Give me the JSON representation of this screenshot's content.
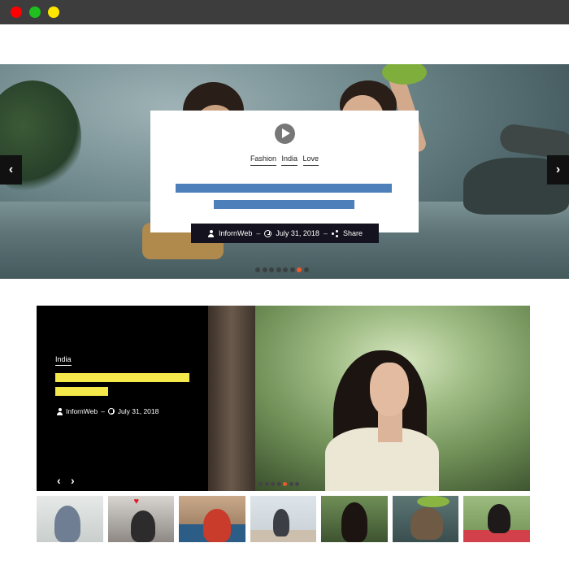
{
  "window": {
    "controls": [
      "close",
      "minimize",
      "maximize"
    ]
  },
  "hero": {
    "categories": [
      "Fashion",
      "India",
      "Love"
    ],
    "play_icon": "play-circle-icon",
    "meta": {
      "author": "InfornWeb",
      "date": "July 31, 2018",
      "share": "Share",
      "separator": "–"
    },
    "prev_arrow": "‹",
    "next_arrow": "›",
    "dots_count": 8,
    "active_dot": 7,
    "title_bar_color": "#4d7fba"
  },
  "feature": {
    "category": "India",
    "meta": {
      "author": "InfornWeb",
      "date": "July 31, 2018",
      "separator": "–"
    },
    "prev_arrow": "‹",
    "next_arrow": "›",
    "dots_count": 7,
    "active_dot": 5,
    "title_bar_color": "#f5e84b"
  },
  "thumbnails": [
    {
      "alt": "woman-on-couch"
    },
    {
      "alt": "couple-with-hearts"
    },
    {
      "alt": "woman-on-sofa"
    },
    {
      "alt": "family-at-beach"
    },
    {
      "alt": "woman-in-forest"
    },
    {
      "alt": "kids-in-rain"
    },
    {
      "alt": "woman-on-blanket"
    }
  ],
  "colors": {
    "accent": "#f05a2a",
    "dark": "#13121e"
  }
}
